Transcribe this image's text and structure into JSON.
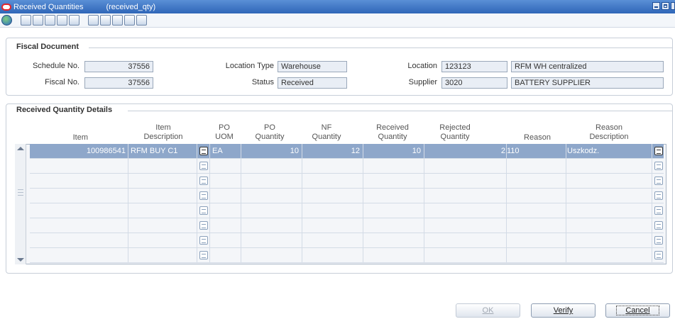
{
  "window": {
    "title": "Received Quantities",
    "code": "(received_qty)"
  },
  "toolbar": {
    "icons": [
      "globe-icon",
      "help-icon",
      "lookup-icon",
      "calendar-icon",
      "print-icon",
      "info-icon",
      "grid-icon",
      "check-icon",
      "edit-icon",
      "export-icon",
      "import-icon"
    ]
  },
  "fiscal_document": {
    "title": "Fiscal Document",
    "schedule_label": "Schedule No.",
    "schedule_value": "37556",
    "fiscal_label": "Fiscal No.",
    "fiscal_value": "37556",
    "location_type_label": "Location Type",
    "location_type_value": "Warehouse",
    "status_label": "Status",
    "status_value": "Received",
    "location_label": "Location",
    "location_value": "123123",
    "location_desc": "RFM WH centralized",
    "supplier_label": "Supplier",
    "supplier_value": "3020",
    "supplier_desc": "BATTERY SUPPLIER"
  },
  "details": {
    "title": "Received Quantity Details",
    "columns": {
      "item": "Item",
      "item_desc_1": "Item",
      "item_desc_2": "Description",
      "po_uom_1": "PO",
      "po_uom_2": "UOM",
      "po_qty_1": "PO",
      "po_qty_2": "Quantity",
      "nf_qty_1": "NF",
      "nf_qty_2": "Quantity",
      "recv_qty_1": "Received",
      "recv_qty_2": "Quantity",
      "rej_qty_1": "Rejected",
      "rej_qty_2": "Quantity",
      "reason": "Reason",
      "reason_desc_1": "Reason",
      "reason_desc_2": "Description"
    },
    "rows": [
      {
        "item": "100986541",
        "desc": "RFM BUY C1",
        "uom": "EA",
        "po_qty": "10",
        "nf_qty": "12",
        "recv_qty": "10",
        "rej_qty": "2",
        "reason": "110",
        "reason_desc": "Uszkodz."
      }
    ]
  },
  "buttons": {
    "ok": "OK",
    "verify": "Verify",
    "cancel": "Cancel"
  }
}
